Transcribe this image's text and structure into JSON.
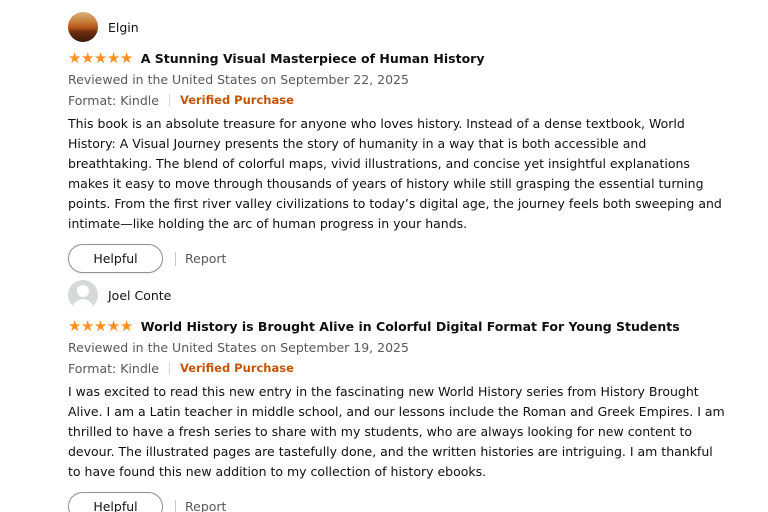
{
  "reviews": [
    {
      "reviewer": "Elgin",
      "rating": 5,
      "title": "A Stunning Visual Masterpiece of Human History",
      "date": "Reviewed in the United States on September 22, 2025",
      "format": "Format: Kindle",
      "verified": "Verified Purchase",
      "body": "This book is an absolute treasure for anyone who loves history. Instead of a dense textbook, World History: A Visual Journey presents the story of humanity in a way that is both accessible and breathtaking. The blend of colorful maps, vivid illustrations, and concise yet insightful explanations makes it easy to move through thousands of years of history while still grasping the essential turning points. From the first river valley civilizations to today’s digital age, the journey feels both sweeping and intimate—like holding the arc of human progress in your hands.",
      "helpful_label": "Helpful",
      "report_label": "Report"
    },
    {
      "reviewer": "Joel Conte",
      "rating": 5,
      "title": "World History is Brought Alive in Colorful Digital Format For Young Students",
      "date": "Reviewed in the United States on September 19, 2025",
      "format": "Format: Kindle",
      "verified": "Verified Purchase",
      "body": "I was excited to read this new entry in the fascinating new World History series from History Brought Alive. I am a Latin teacher in middle school, and our lessons include the Roman and Greek Empires. I am thrilled to have a fresh series to share with my students, who are always looking for new content to devour. The illustrated pages are tastefully done, and the written histories are intriguing. I am thankful to have found this new addition to my collection of history ebooks.",
      "helpful_label": "Helpful",
      "report_label": "Report"
    }
  ],
  "icons": {
    "star": "star-icon",
    "avatar_photo": "avatar-photo-icon",
    "avatar_default": "default-avatar-icon"
  },
  "colors": {
    "star": "#ff8f1f",
    "verified": "#c45500",
    "secondary_text": "#565959"
  }
}
